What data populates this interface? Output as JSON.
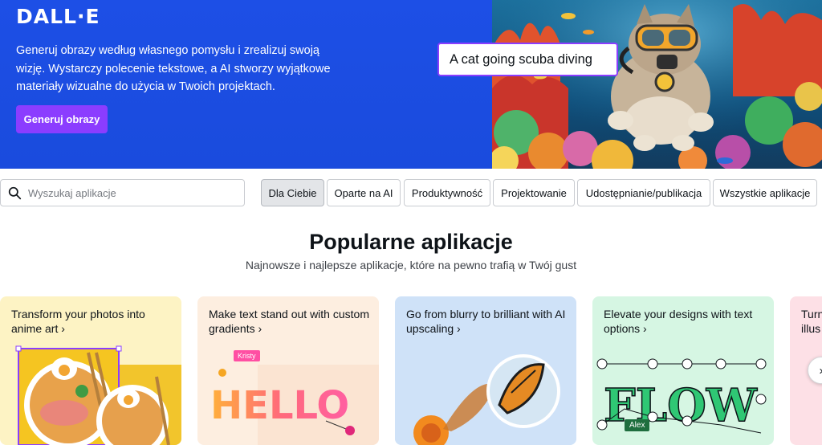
{
  "hero": {
    "logo": "DALL·E",
    "description": "Generuj obrazy według własnego pomysłu i zrealizuj swoją wizję. Wystarczy polecenie tekstowe, a AI stworzy wyjątkowe materiały wizualne do użycia w Twoich projektach.",
    "cta_label": "Generuj obrazy",
    "prompt_example": "A cat going scuba diving"
  },
  "search": {
    "placeholder": "Wyszukaj aplikacje"
  },
  "filters": [
    {
      "label": "Dla Ciebie",
      "active": true
    },
    {
      "label": "Oparte na AI",
      "active": false
    },
    {
      "label": "Produktywność",
      "active": false
    },
    {
      "label": "Projektowanie",
      "active": false
    },
    {
      "label": "Udostępnianie/publikacja",
      "active": false
    },
    {
      "label": "Wszystkie aplikacje",
      "active": false
    }
  ],
  "section": {
    "title": "Popularne aplikacje",
    "subtitle": "Najnowsze i najlepsze aplikacje, które na pewno trafią w Twój gust"
  },
  "cards": [
    {
      "title": "Transform your photos into anime art ›",
      "bg": "#fdf3c4"
    },
    {
      "title": "Make text stand out with custom gradients ›",
      "bg": "#fdeee0",
      "tag": "Kristy",
      "art_text": "HELLO"
    },
    {
      "title": "Go from blurry to brilliant with AI upscaling ›",
      "bg": "#cfe2f8"
    },
    {
      "title": "Elevate your designs with text options ›",
      "bg": "#d6f6e3",
      "tag": "Alex",
      "art_text": "FLOW"
    },
    {
      "title": "Turn illus",
      "bg": "#fde0e6"
    }
  ],
  "colors": {
    "hero_blue": "#1f4de0",
    "accent_purple": "#8b3dff"
  }
}
